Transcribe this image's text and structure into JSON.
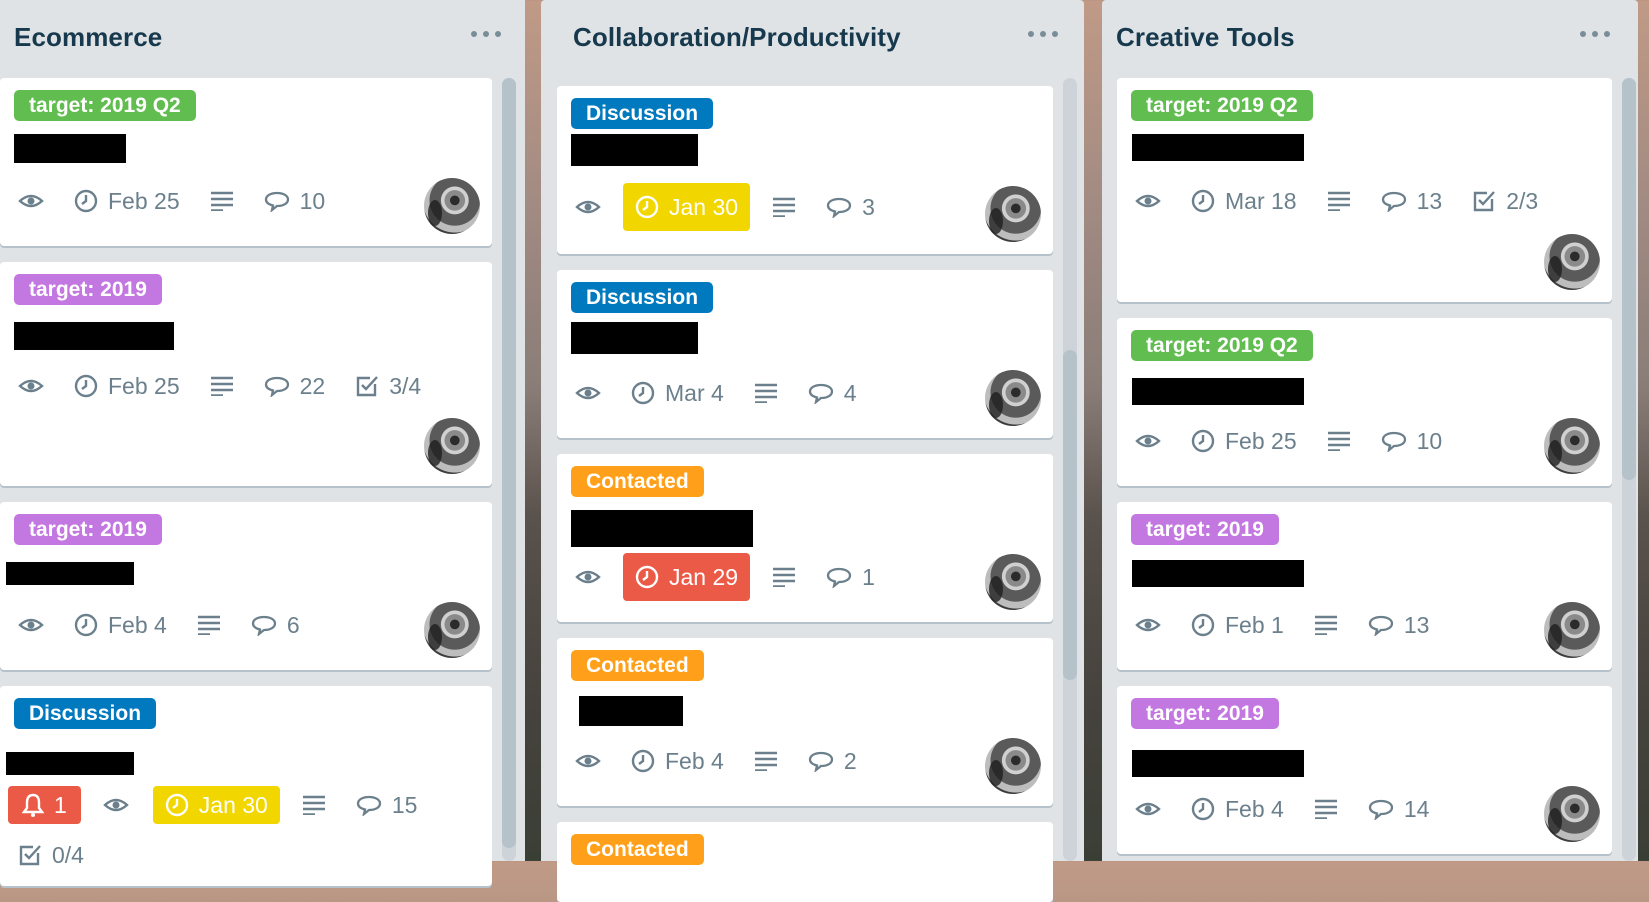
{
  "colors": {
    "list_bg": "#dfe3e6",
    "title": "#17394d",
    "label_green": "#61bd4f",
    "label_purple": "#c377e0",
    "label_blue": "#0079bf",
    "label_orange": "#ff9f1a",
    "due_yellow": "#f2d600",
    "due_red": "#eb5a46",
    "badge_text": "#6b808c"
  },
  "lists": [
    {
      "title": "Ecommerce",
      "cards": [
        {
          "label": "target: 2019 Q2",
          "label_color": "green",
          "due": "Feb 25",
          "comments": "10"
        },
        {
          "label": "target: 2019",
          "label_color": "purple",
          "due": "Feb 25",
          "comments": "22",
          "checklist": "3/4"
        },
        {
          "label": "target: 2019",
          "label_color": "purple",
          "due": "Feb 4",
          "comments": "6"
        },
        {
          "label": "Discussion",
          "label_color": "blue",
          "notifications": "1",
          "due": "Jan 30",
          "due_state": "due-soon",
          "comments": "15",
          "checklist": "0/4"
        }
      ]
    },
    {
      "title": "Collaboration/Productivity",
      "cards": [
        {
          "label": "Discussion",
          "label_color": "blue",
          "due": "Jan 30",
          "due_state": "due-soon",
          "comments": "3"
        },
        {
          "label": "Discussion",
          "label_color": "blue",
          "due": "Mar 4",
          "comments": "4"
        },
        {
          "label": "Contacted",
          "label_color": "orange",
          "due": "Jan 29",
          "due_state": "overdue",
          "comments": "1"
        },
        {
          "label": "Contacted",
          "label_color": "orange",
          "due": "Feb 4",
          "comments": "2"
        },
        {
          "label": "Contacted",
          "label_color": "orange"
        }
      ]
    },
    {
      "title": "Creative Tools",
      "cards": [
        {
          "label": "target: 2019 Q2",
          "label_color": "green",
          "due": "Mar 18",
          "comments": "13",
          "checklist": "2/3"
        },
        {
          "label": "target: 2019 Q2",
          "label_color": "green",
          "due": "Feb 25",
          "comments": "10"
        },
        {
          "label": "target: 2019",
          "label_color": "purple",
          "due": "Feb 1",
          "comments": "13"
        },
        {
          "label": "target: 2019",
          "label_color": "purple",
          "due": "Feb 4",
          "comments": "14"
        }
      ]
    }
  ],
  "icons": {
    "watch": "eye-icon",
    "due": "clock-icon",
    "description": "description-icon",
    "comments": "comment-icon",
    "checklist": "checklist-icon",
    "notification": "bell-icon",
    "menu": "more-icon"
  }
}
